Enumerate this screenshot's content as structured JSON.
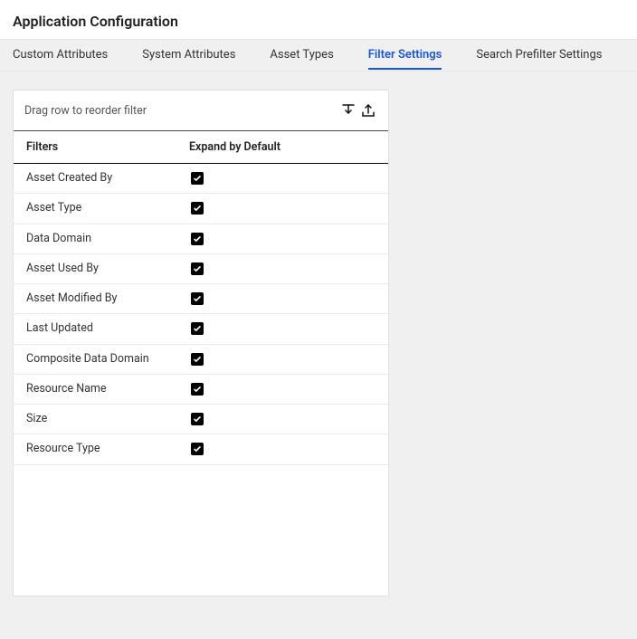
{
  "header": {
    "title": "Application Configuration"
  },
  "tabs": [
    {
      "label": "Custom Attributes",
      "active": false
    },
    {
      "label": "System Attributes",
      "active": false
    },
    {
      "label": "Asset Types",
      "active": false
    },
    {
      "label": "Filter Settings",
      "active": true
    },
    {
      "label": "Search Prefilter Settings",
      "active": false
    }
  ],
  "panel": {
    "hint": "Drag row to reorder filter",
    "columns": {
      "filters": "Filters",
      "expand": "Expand by Default"
    },
    "rows": [
      {
        "label": "Asset Created By",
        "checked": true
      },
      {
        "label": "Asset Type",
        "checked": true
      },
      {
        "label": "Data Domain",
        "checked": true
      },
      {
        "label": "Asset Used By",
        "checked": true
      },
      {
        "label": "Asset Modified By",
        "checked": true
      },
      {
        "label": "Last Updated",
        "checked": true
      },
      {
        "label": "Composite Data Domain",
        "checked": true
      },
      {
        "label": "Resource Name",
        "checked": true
      },
      {
        "label": "Size",
        "checked": true
      },
      {
        "label": "Resource Type",
        "checked": true
      }
    ]
  }
}
